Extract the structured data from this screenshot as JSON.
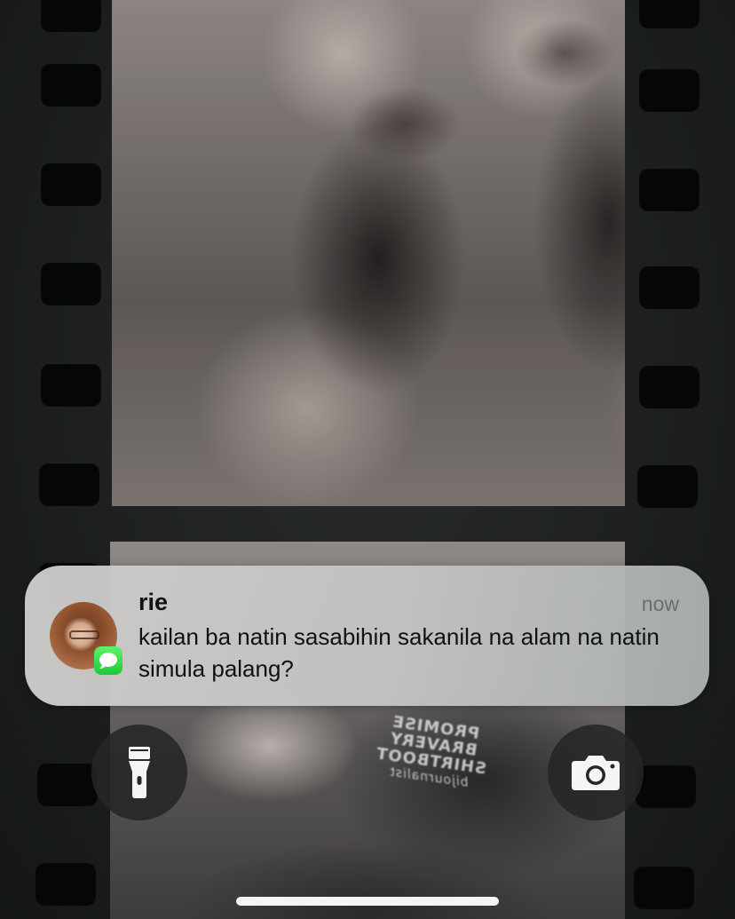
{
  "notification": {
    "sender": "rie",
    "time": "now",
    "message": "kailan ba natin sasabihin sakanila na alam na natin simula palang?",
    "app_icon": "messages-icon",
    "avatar": "contact-photo"
  },
  "wallpaper": {
    "shirt_text_lines": [
      "PROMISE",
      "BRAVERY",
      "SHIRTBOOT"
    ],
    "shirt_script": "bijournalist"
  },
  "quick_actions": {
    "left_icon": "flashlight-icon",
    "right_icon": "camera-icon"
  },
  "colors": {
    "badge_green": "#28CD41",
    "button_bg": "#262626",
    "home_indicator": "#F4F4F4"
  }
}
